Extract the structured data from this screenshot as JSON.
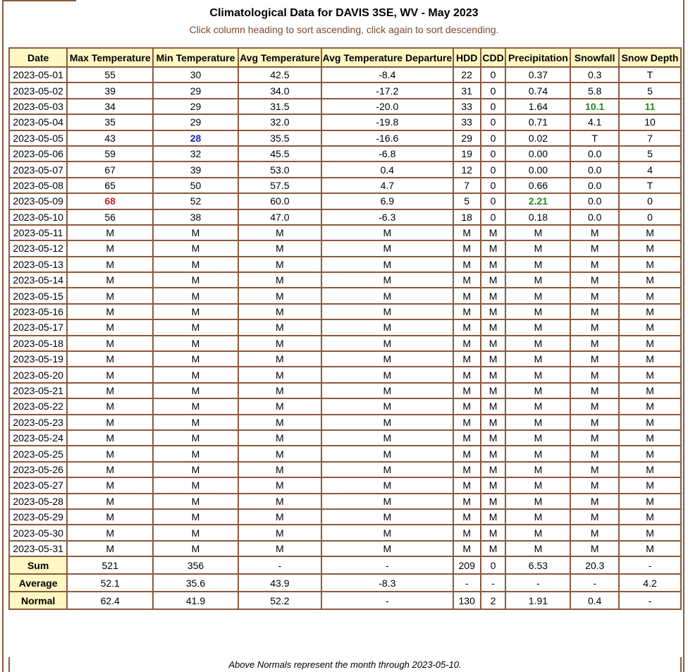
{
  "header": {
    "title": "Climatological Data for DAVIS 3SE, WV - May 2023",
    "subtitle": "Click column heading to sort ascending, click again to sort descending."
  },
  "columns": [
    "Date",
    "Max Temperature",
    "Min Temperature",
    "Avg Temperature",
    "Avg Temperature Departure",
    "HDD",
    "CDD",
    "Precipitation",
    "Snowfall",
    "Snow Depth"
  ],
  "rows": [
    [
      "2023-05-01",
      "55",
      "30",
      "42.5",
      "-8.4",
      "22",
      "0",
      "0.37",
      "0.3",
      "T"
    ],
    [
      "2023-05-02",
      "39",
      "29",
      "34.0",
      "-17.2",
      "31",
      "0",
      "0.74",
      "5.8",
      "5"
    ],
    [
      "2023-05-03",
      "34",
      "29",
      "31.5",
      "-20.0",
      "33",
      "0",
      "1.64",
      "10.1",
      "11"
    ],
    [
      "2023-05-04",
      "35",
      "29",
      "32.0",
      "-19.8",
      "33",
      "0",
      "0.71",
      "4.1",
      "10"
    ],
    [
      "2023-05-05",
      "43",
      "28",
      "35.5",
      "-16.6",
      "29",
      "0",
      "0.02",
      "T",
      "7"
    ],
    [
      "2023-05-06",
      "59",
      "32",
      "45.5",
      "-6.8",
      "19",
      "0",
      "0.00",
      "0.0",
      "5"
    ],
    [
      "2023-05-07",
      "67",
      "39",
      "53.0",
      "0.4",
      "12",
      "0",
      "0.00",
      "0.0",
      "4"
    ],
    [
      "2023-05-08",
      "65",
      "50",
      "57.5",
      "4.7",
      "7",
      "0",
      "0.66",
      "0.0",
      "T"
    ],
    [
      "2023-05-09",
      "68",
      "52",
      "60.0",
      "6.9",
      "5",
      "0",
      "2.21",
      "0.0",
      "0"
    ],
    [
      "2023-05-10",
      "56",
      "38",
      "47.0",
      "-6.3",
      "18",
      "0",
      "0.18",
      "0.0",
      "0"
    ],
    [
      "2023-05-11",
      "M",
      "M",
      "M",
      "M",
      "M",
      "M",
      "M",
      "M",
      "M"
    ],
    [
      "2023-05-12",
      "M",
      "M",
      "M",
      "M",
      "M",
      "M",
      "M",
      "M",
      "M"
    ],
    [
      "2023-05-13",
      "M",
      "M",
      "M",
      "M",
      "M",
      "M",
      "M",
      "M",
      "M"
    ],
    [
      "2023-05-14",
      "M",
      "M",
      "M",
      "M",
      "M",
      "M",
      "M",
      "M",
      "M"
    ],
    [
      "2023-05-15",
      "M",
      "M",
      "M",
      "M",
      "M",
      "M",
      "M",
      "M",
      "M"
    ],
    [
      "2023-05-16",
      "M",
      "M",
      "M",
      "M",
      "M",
      "M",
      "M",
      "M",
      "M"
    ],
    [
      "2023-05-17",
      "M",
      "M",
      "M",
      "M",
      "M",
      "M",
      "M",
      "M",
      "M"
    ],
    [
      "2023-05-18",
      "M",
      "M",
      "M",
      "M",
      "M",
      "M",
      "M",
      "M",
      "M"
    ],
    [
      "2023-05-19",
      "M",
      "M",
      "M",
      "M",
      "M",
      "M",
      "M",
      "M",
      "M"
    ],
    [
      "2023-05-20",
      "M",
      "M",
      "M",
      "M",
      "M",
      "M",
      "M",
      "M",
      "M"
    ],
    [
      "2023-05-21",
      "M",
      "M",
      "M",
      "M",
      "M",
      "M",
      "M",
      "M",
      "M"
    ],
    [
      "2023-05-22",
      "M",
      "M",
      "M",
      "M",
      "M",
      "M",
      "M",
      "M",
      "M"
    ],
    [
      "2023-05-23",
      "M",
      "M",
      "M",
      "M",
      "M",
      "M",
      "M",
      "M",
      "M"
    ],
    [
      "2023-05-24",
      "M",
      "M",
      "M",
      "M",
      "M",
      "M",
      "M",
      "M",
      "M"
    ],
    [
      "2023-05-25",
      "M",
      "M",
      "M",
      "M",
      "M",
      "M",
      "M",
      "M",
      "M"
    ],
    [
      "2023-05-26",
      "M",
      "M",
      "M",
      "M",
      "M",
      "M",
      "M",
      "M",
      "M"
    ],
    [
      "2023-05-27",
      "M",
      "M",
      "M",
      "M",
      "M",
      "M",
      "M",
      "M",
      "M"
    ],
    [
      "2023-05-28",
      "M",
      "M",
      "M",
      "M",
      "M",
      "M",
      "M",
      "M",
      "M"
    ],
    [
      "2023-05-29",
      "M",
      "M",
      "M",
      "M",
      "M",
      "M",
      "M",
      "M",
      "M"
    ],
    [
      "2023-05-30",
      "M",
      "M",
      "M",
      "M",
      "M",
      "M",
      "M",
      "M",
      "M"
    ],
    [
      "2023-05-31",
      "M",
      "M",
      "M",
      "M",
      "M",
      "M",
      "M",
      "M",
      "M"
    ]
  ],
  "highlights": [
    {
      "row": 8,
      "col": 1,
      "style": "red"
    },
    {
      "row": 4,
      "col": 2,
      "style": "blue"
    },
    {
      "row": 8,
      "col": 7,
      "style": "green"
    },
    {
      "row": 2,
      "col": 8,
      "style": "green"
    },
    {
      "row": 2,
      "col": 9,
      "style": "green"
    }
  ],
  "highlight_colors": {
    "red": "#cc2222",
    "blue": "#2222bb",
    "green": "#228822"
  },
  "summary": [
    [
      "Sum",
      "521",
      "356",
      "-",
      "-",
      "209",
      "0",
      "6.53",
      "20.3",
      "-"
    ],
    [
      "Average",
      "52.1",
      "35.6",
      "43.9",
      "-8.3",
      "-",
      "-",
      "-",
      "-",
      "4.2"
    ],
    [
      "Normal",
      "62.4",
      "41.9",
      "52.2",
      "-",
      "130",
      "2",
      "1.91",
      "0.4",
      "-"
    ]
  ],
  "footnote": "Above Normals represent the month through 2023-05-10.",
  "colors": {
    "border": "#8b5a3c",
    "header_bg": "#fff7c4",
    "subtitle": "#7a4a2e"
  }
}
